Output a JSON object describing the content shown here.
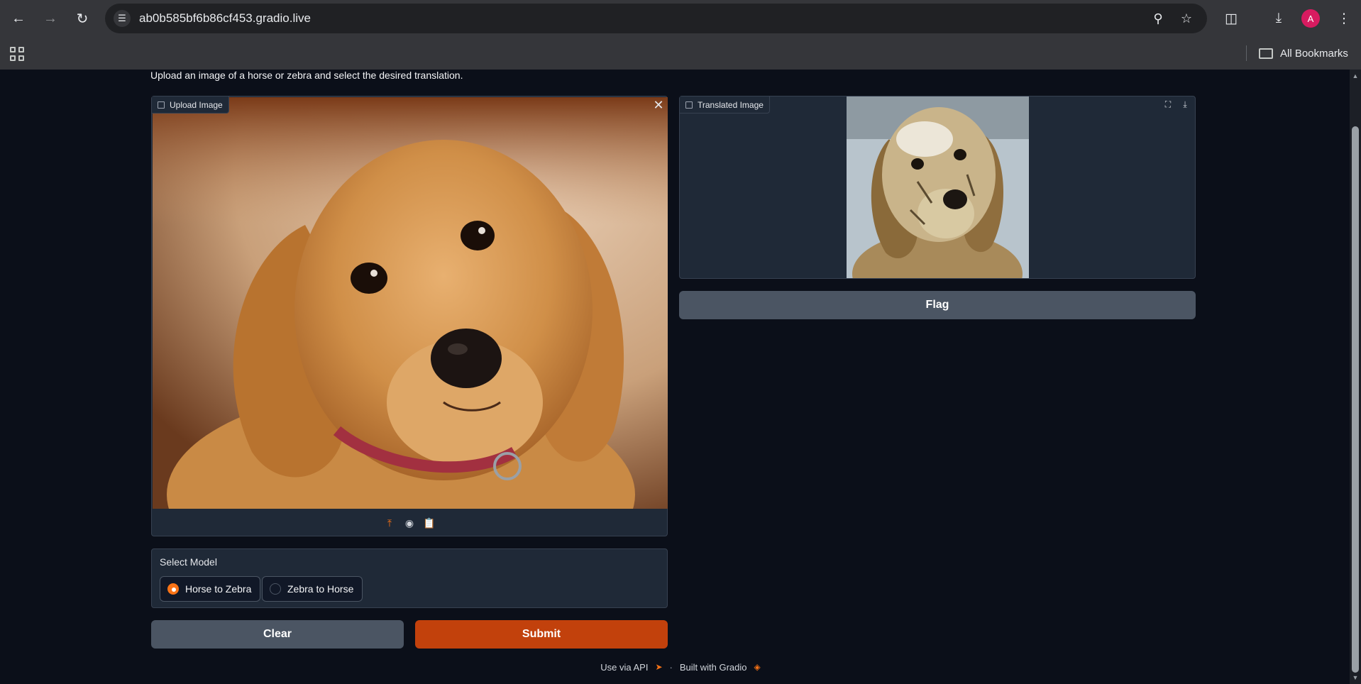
{
  "browser": {
    "url": "ab0b585bf6b86cf453.gradio.live",
    "avatar_letter": "A",
    "bookmarks_label": "All Bookmarks"
  },
  "page": {
    "description": "Upload an image of a horse or zebra and select the desired translation.",
    "upload": {
      "label": "Upload Image"
    },
    "output": {
      "label": "Translated Image"
    },
    "flag_label": "Flag",
    "model": {
      "label": "Select Model",
      "options": [
        "Horse to Zebra",
        "Zebra to Horse"
      ],
      "selected": "Horse to Zebra"
    },
    "clear_label": "Clear",
    "submit_label": "Submit",
    "footer": {
      "api_label": "Use via API",
      "separator": "·",
      "built_label": "Built with Gradio"
    }
  },
  "colors": {
    "accent": "#f97316",
    "submit": "#c2410c",
    "background": "#0b0f19"
  }
}
